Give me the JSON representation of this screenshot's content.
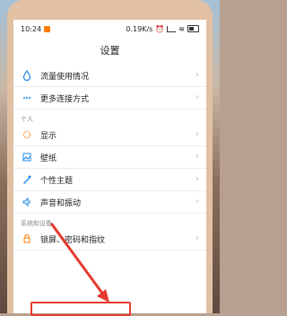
{
  "status": {
    "time": "10:24",
    "network_speed": "0.19K/s"
  },
  "page_title": "设置",
  "sections": {
    "personal": "个人",
    "system": "系统和设备"
  },
  "items": {
    "traffic": "流量使用情况",
    "more_conn": "更多连接方式",
    "display": "显示",
    "wallpaper": "壁纸",
    "theme": "个性主题",
    "sound": "声音和振动",
    "lock": "锁屏、密码和指纹"
  },
  "icons": {
    "traffic": "water-drop-icon",
    "more_conn": "ellipsis-icon",
    "display": "sun-icon",
    "wallpaper": "image-icon",
    "theme": "brush-icon",
    "sound": "speaker-icon",
    "lock": "lock-icon",
    "chevron": "chevron-right-icon"
  },
  "colors": {
    "accent_blue": "#1e88e5",
    "accent_orange": "#ff7a00",
    "annotation_red": "#e63a2e"
  }
}
